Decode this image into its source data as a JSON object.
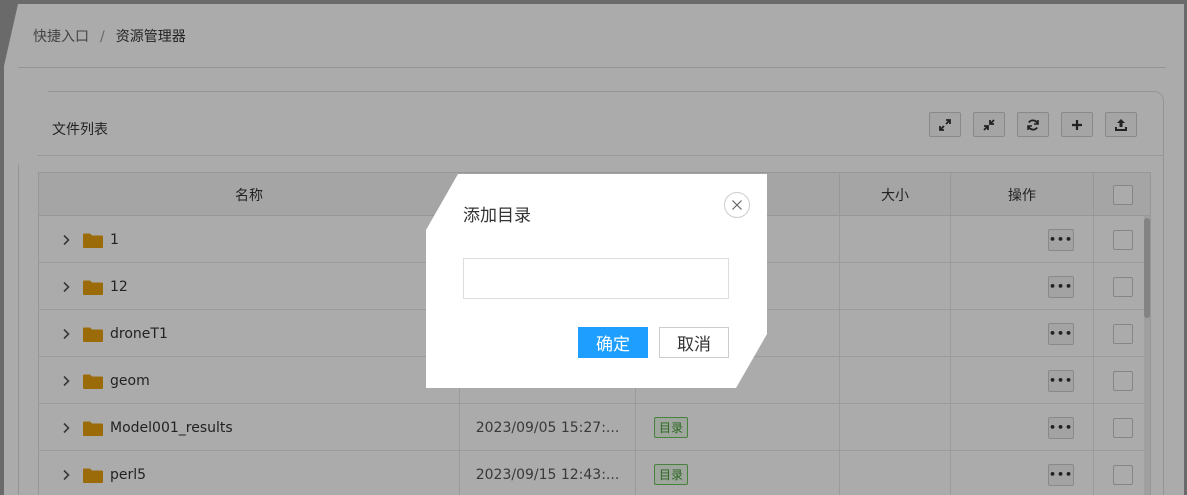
{
  "breadcrumb": {
    "items": [
      "快捷入口",
      "资源管理器"
    ],
    "separator": "/"
  },
  "panel": {
    "title": "文件列表"
  },
  "toolbar": [
    {
      "name": "expand-all-button",
      "icon": "expand-arrows-icon"
    },
    {
      "name": "collapse-all-button",
      "icon": "compress-arrows-icon"
    },
    {
      "name": "refresh-button",
      "icon": "refresh-icon"
    },
    {
      "name": "add-button",
      "icon": "plus-icon"
    },
    {
      "name": "upload-button",
      "icon": "upload-icon"
    }
  ],
  "table": {
    "columns": {
      "name": "名称",
      "time": "",
      "type": "",
      "size": "大小",
      "ops": "操作"
    },
    "rows": [
      {
        "name": "1",
        "time": "",
        "type": ""
      },
      {
        "name": "12",
        "time": "",
        "type": ""
      },
      {
        "name": "droneT1",
        "time": "",
        "type": ""
      },
      {
        "name": "geom",
        "time": "",
        "type": ""
      },
      {
        "name": "Model001_results",
        "time": "2023/09/05 15:27:...",
        "type": "目录"
      },
      {
        "name": "perl5",
        "time": "2023/09/15 12:43:...",
        "type": "目录"
      }
    ],
    "more_label": "•••"
  },
  "dialog": {
    "title": "添加目录",
    "input_value": "",
    "input_placeholder": "",
    "confirm_label": "确定",
    "cancel_label": "取消"
  },
  "colors": {
    "primary": "#1e9fff",
    "folder": "#e8a010",
    "tag_border": "#6cbf5c",
    "tag_text": "#3f9a2f",
    "overlay": "rgba(0,0,0,0.33)"
  }
}
